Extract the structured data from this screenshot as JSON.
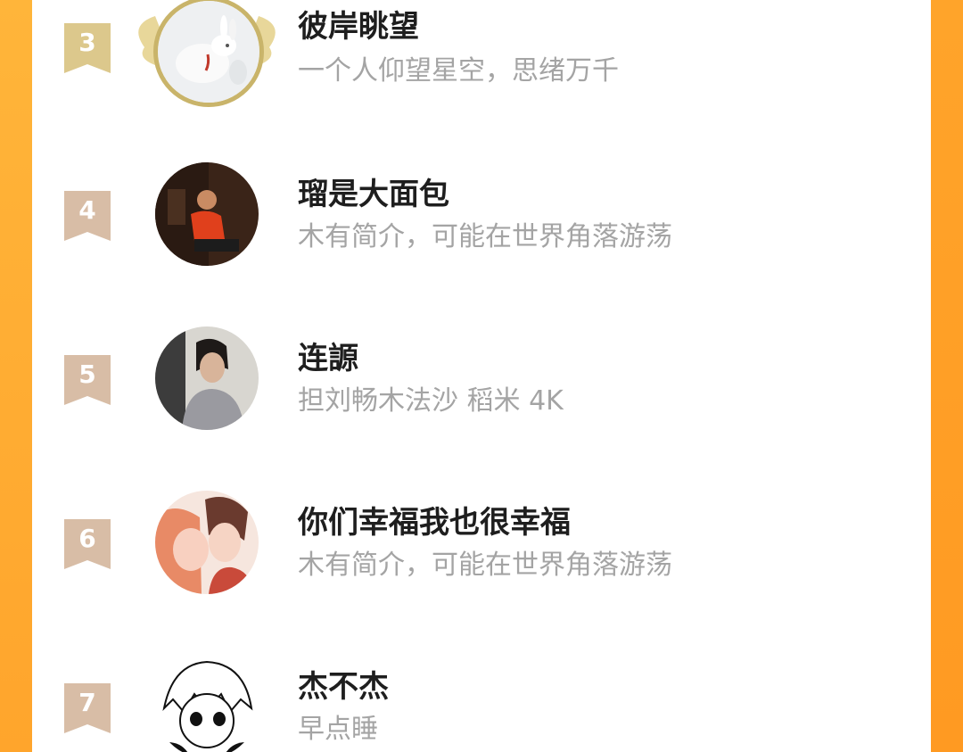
{
  "ranking": {
    "items": [
      {
        "rank": "3",
        "name": "彼岸眺望",
        "bio": "一个人仰望星空，思绪万千",
        "avatar_icon": "white-rabbit-avatar",
        "frame_icon": "gold-wings-frame-icon"
      },
      {
        "rank": "4",
        "name": "瑠是大面包",
        "bio": "木有简介，可能在世界角落游荡",
        "avatar_icon": "person-red-shirt-avatar"
      },
      {
        "rank": "5",
        "name": "连謜",
        "bio": "担刘畅木法沙 稻米 4K",
        "avatar_icon": "man-portrait-avatar"
      },
      {
        "rank": "6",
        "name": "你们幸福我也很幸福",
        "bio": "木有简介，可能在世界角落游荡",
        "avatar_icon": "anime-couple-avatar"
      },
      {
        "rank": "7",
        "name": "杰不杰",
        "bio": "早点睡",
        "avatar_icon": "manga-boy-avatar"
      }
    ]
  },
  "colors": {
    "background_orange": "#ffac30",
    "card": "#ffffff",
    "rank3_badge": "#dcc88c",
    "rank_badge": "#d8bda6",
    "name_text": "#1e1e1e",
    "bio_text": "#a4a4a4",
    "gold_frame": "#c9b46a"
  }
}
